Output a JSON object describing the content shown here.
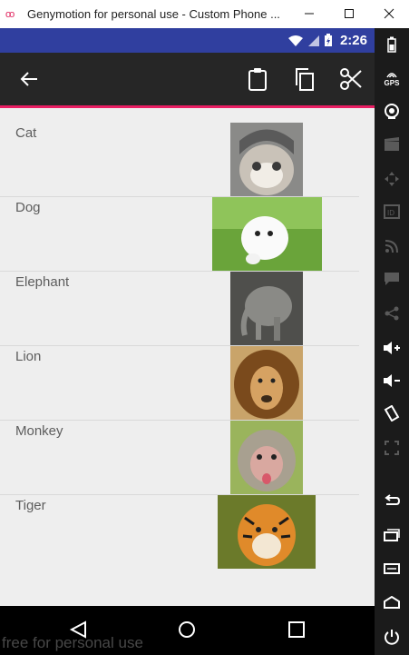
{
  "window": {
    "title": "Genymotion for personal use - Custom Phone ...",
    "logo": "oo"
  },
  "status_bar": {
    "time": "2:26"
  },
  "toolbar": {
    "icons": [
      "back-arrow-icon",
      "clipboard-icon",
      "copy-icon",
      "scissors-icon"
    ]
  },
  "animals": [
    {
      "label": "Cat"
    },
    {
      "label": "Dog"
    },
    {
      "label": "Elephant"
    },
    {
      "label": "Lion"
    },
    {
      "label": "Monkey"
    },
    {
      "label": "Tiger"
    }
  ],
  "side_panel": {
    "gps_label": "GPS"
  },
  "watermark": "free for personal use",
  "colors": {
    "status_bar": "#303f9f",
    "toolbar": "#262626",
    "accent": "#e91e63",
    "list_bg": "#eeeeee"
  }
}
